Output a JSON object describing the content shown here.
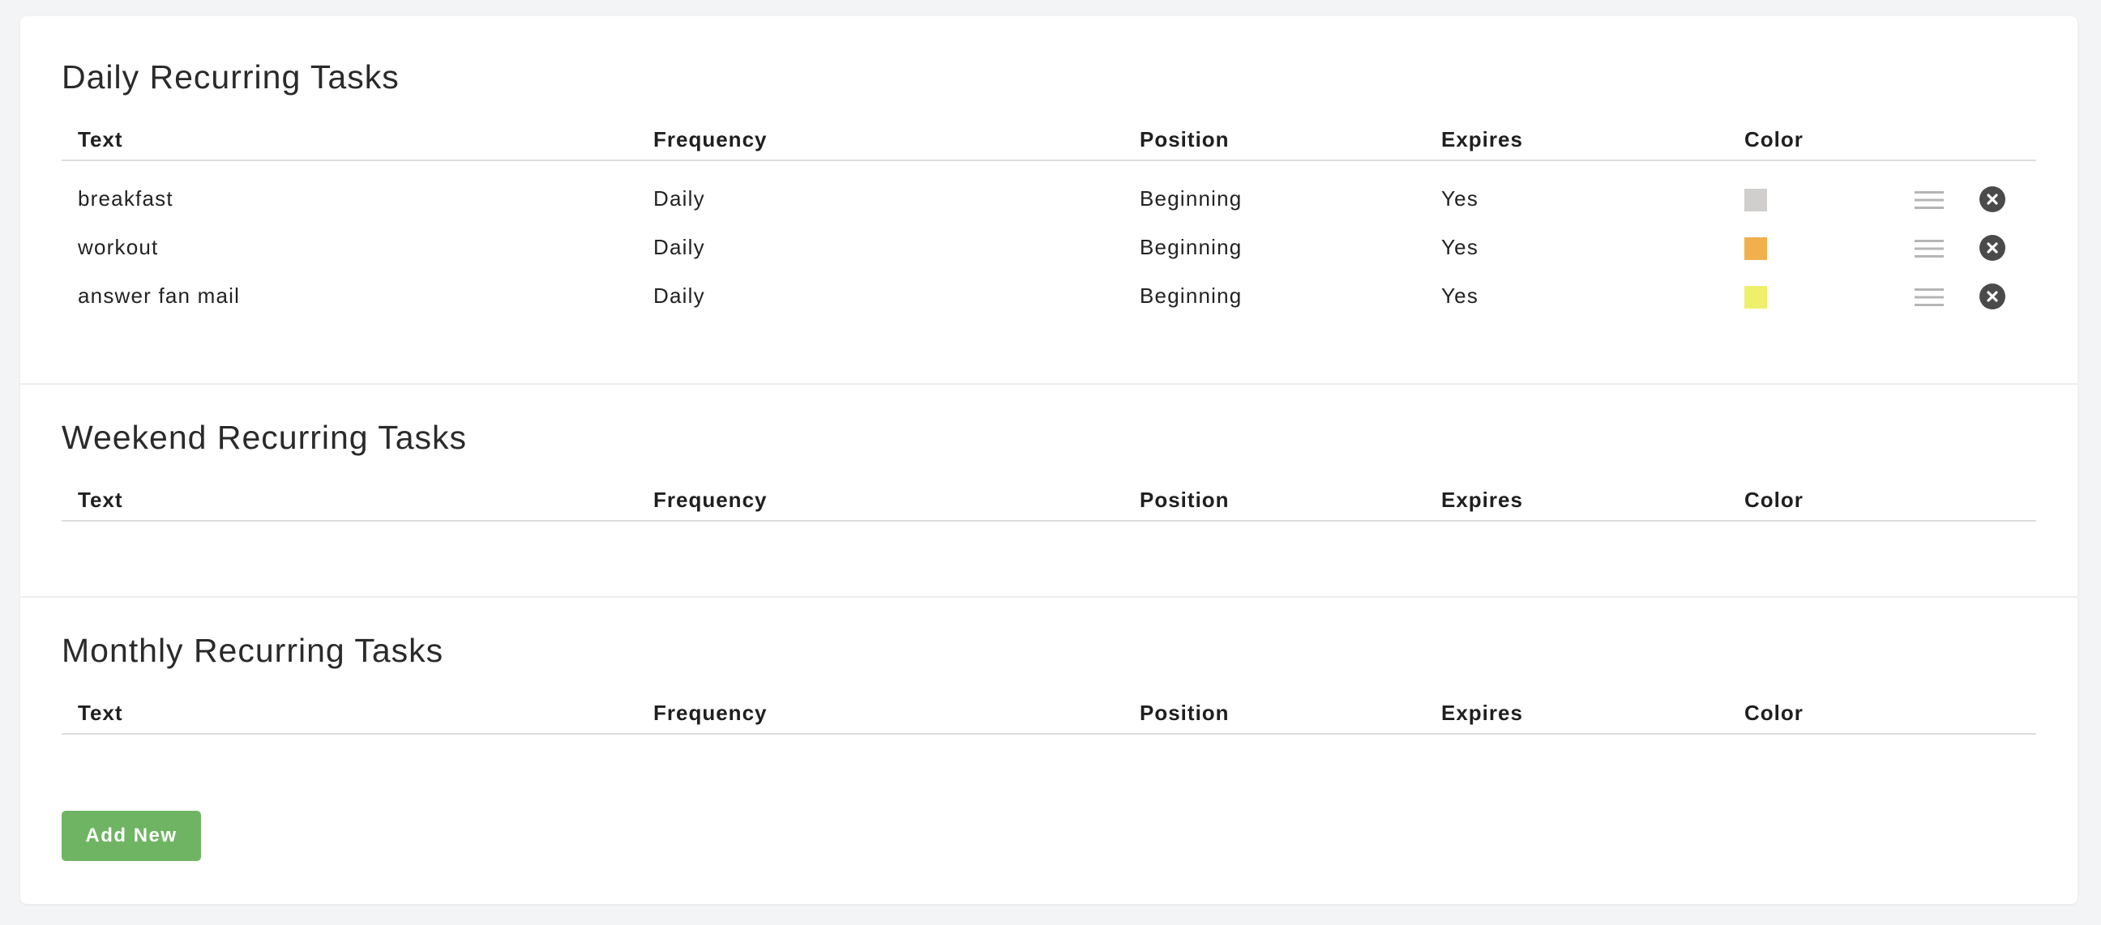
{
  "columns": {
    "text": "Text",
    "frequency": "Frequency",
    "position": "Position",
    "expires": "Expires",
    "color": "Color"
  },
  "daily": {
    "title": "Daily Recurring Tasks",
    "rows": [
      {
        "text": "breakfast",
        "frequency": "Daily",
        "position": "Beginning",
        "expires": "Yes",
        "color": "#d1cfcd"
      },
      {
        "text": "workout",
        "frequency": "Daily",
        "position": "Beginning",
        "expires": "Yes",
        "color": "#f2b04c"
      },
      {
        "text": "answer fan mail",
        "frequency": "Daily",
        "position": "Beginning",
        "expires": "Yes",
        "color": "#eef06b"
      }
    ]
  },
  "weekend": {
    "title": "Weekend Recurring Tasks",
    "rows": []
  },
  "monthly": {
    "title": "Monthly Recurring Tasks",
    "rows": []
  },
  "add_button_label": "Add New",
  "icons": {
    "drag": "drag-handle-icon",
    "delete": "close-circle-icon"
  },
  "colors": {
    "accent_green": "#6fb463",
    "delete_icon_bg": "#4a4a4a",
    "drag_icon": "#b5b5b5"
  }
}
